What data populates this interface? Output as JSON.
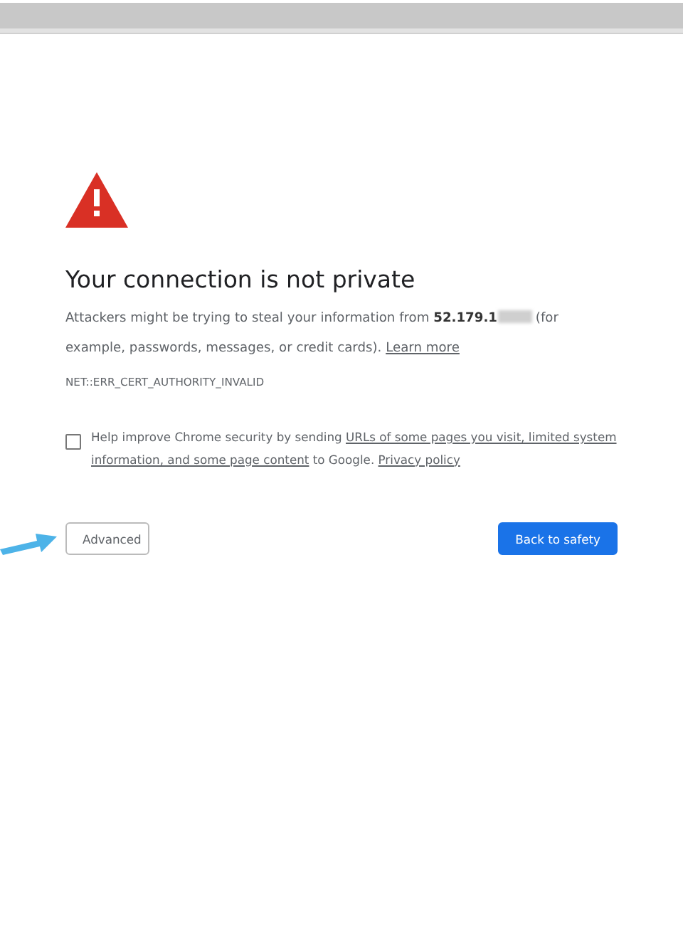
{
  "heading": "Your connection is not private",
  "message": {
    "before": "Attackers might be trying to steal your information from **52.179.1**",
    "after": " (for example, passwords, messages, or credit cards). ",
    "link": "Learn more"
  },
  "error_code": "NET::ERR_CERT_AUTHORITY_INVALID",
  "consent": {
    "checked": false,
    "before": "Help improve Chrome security by sending ",
    "link_lines": [
      "URLs of some pages you visit, limited system",
      "information, and some page content"
    ],
    "middle": " to Google. ",
    "policy_link": "Privacy policy"
  },
  "buttons": [
    {
      "kind": "secondary",
      "label": "Advanced"
    },
    {
      "kind": "primary",
      "label": "Back to safety"
    }
  ]
}
